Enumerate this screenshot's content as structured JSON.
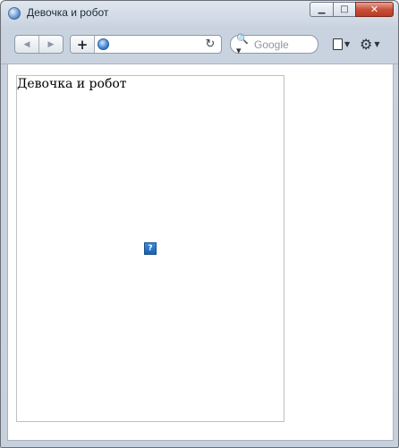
{
  "window": {
    "title": "Девочка и робот",
    "controls": {
      "minimize": "▁",
      "maximize": "□",
      "close": "✕"
    }
  },
  "toolbar": {
    "back_icon": "◀",
    "forward_icon": "▶",
    "add_icon": "+",
    "address": {
      "value": "",
      "placeholder": ""
    },
    "reload_icon": "↻",
    "search": {
      "icon": "🔍▾",
      "placeholder": "Google"
    },
    "page_caret": "▼",
    "gear_icon": "⚙",
    "gear_caret": "▼"
  },
  "content": {
    "image_alt": "Девочка и робот",
    "broken_image_glyph": "?"
  },
  "colors": {
    "chrome": "#c9d3df",
    "close_button": "#c9503b",
    "page_bg": "#ffffff"
  }
}
